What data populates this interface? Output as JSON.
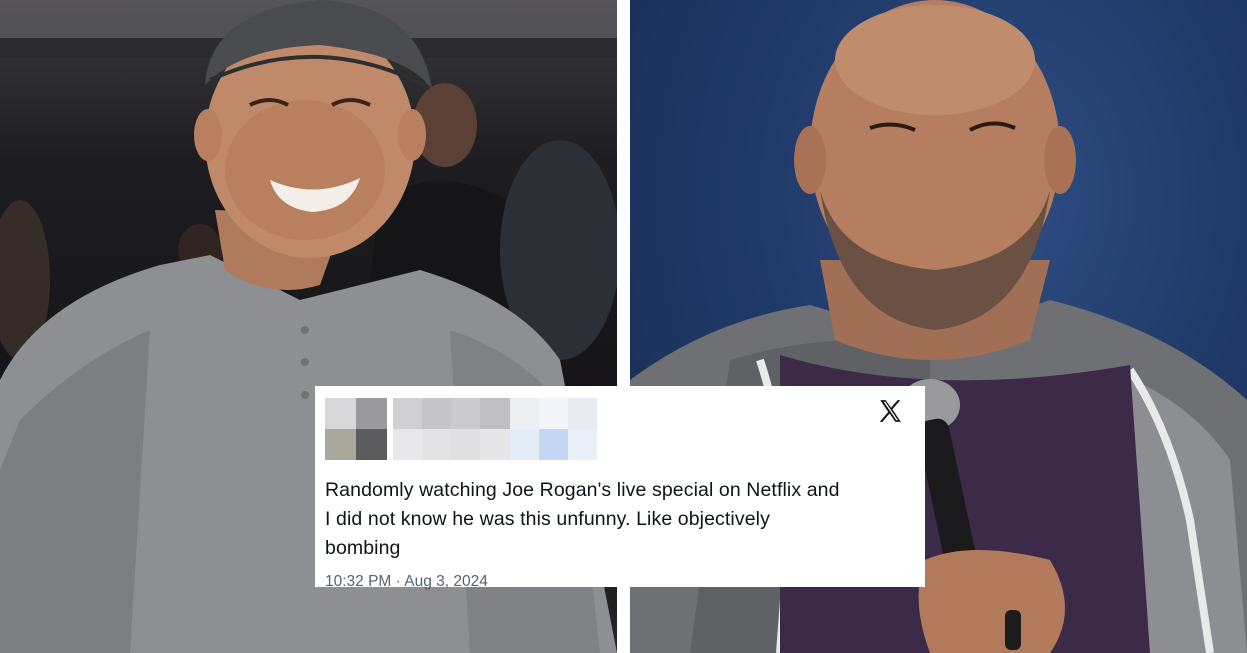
{
  "tweet": {
    "text": "Randomly watching Joe Rogan's live special on Netflix and\nI did not know he was this unfunny. Like objectively\nbombing",
    "time": "10:32 PM",
    "separator": "·",
    "date": "Aug 3, 2024",
    "platform_icon": "x-logo-icon",
    "avatar_state": "pixelated",
    "username_state": "pixelated"
  },
  "photos": [
    {
      "position": "left",
      "subject": "smiling man in grey henley shirt and flat cap at event"
    },
    {
      "position": "right",
      "subject": "man holding microphone in hoodie against blue backdrop"
    }
  ],
  "colors": {
    "text": "#0f1419",
    "meta": "#536471",
    "card_bg": "#ffffff"
  }
}
